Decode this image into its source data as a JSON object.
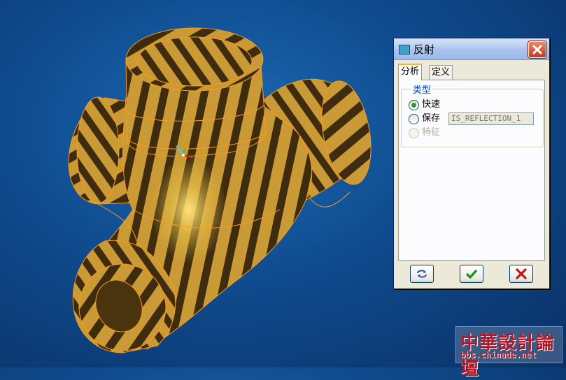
{
  "dialog": {
    "title": "反射",
    "tabs": [
      {
        "label": "分析",
        "active": true
      },
      {
        "label": "定义",
        "active": false
      }
    ],
    "group_label": "类型",
    "options": [
      {
        "label": "快速",
        "checked": true,
        "enabled": true
      },
      {
        "label": "保存",
        "checked": false,
        "enabled": true
      },
      {
        "label": "特征",
        "checked": false,
        "enabled": false
      }
    ],
    "name_input_value": "IS_REFLECTION_1",
    "buttons": [
      "refresh-icon",
      "check-icon",
      "close-x-icon"
    ]
  },
  "watermark": {
    "title": "中華設計論壇",
    "url": "bbs.chinade.net"
  },
  "colors": {
    "background": "#0f4b8e",
    "model_gold": "#d3a63a",
    "model_stripe": "#3f2c0e",
    "edge_orange": "#ff9a1a",
    "confirm_green": "#1d9a1d",
    "cancel_red": "#c0121b"
  }
}
